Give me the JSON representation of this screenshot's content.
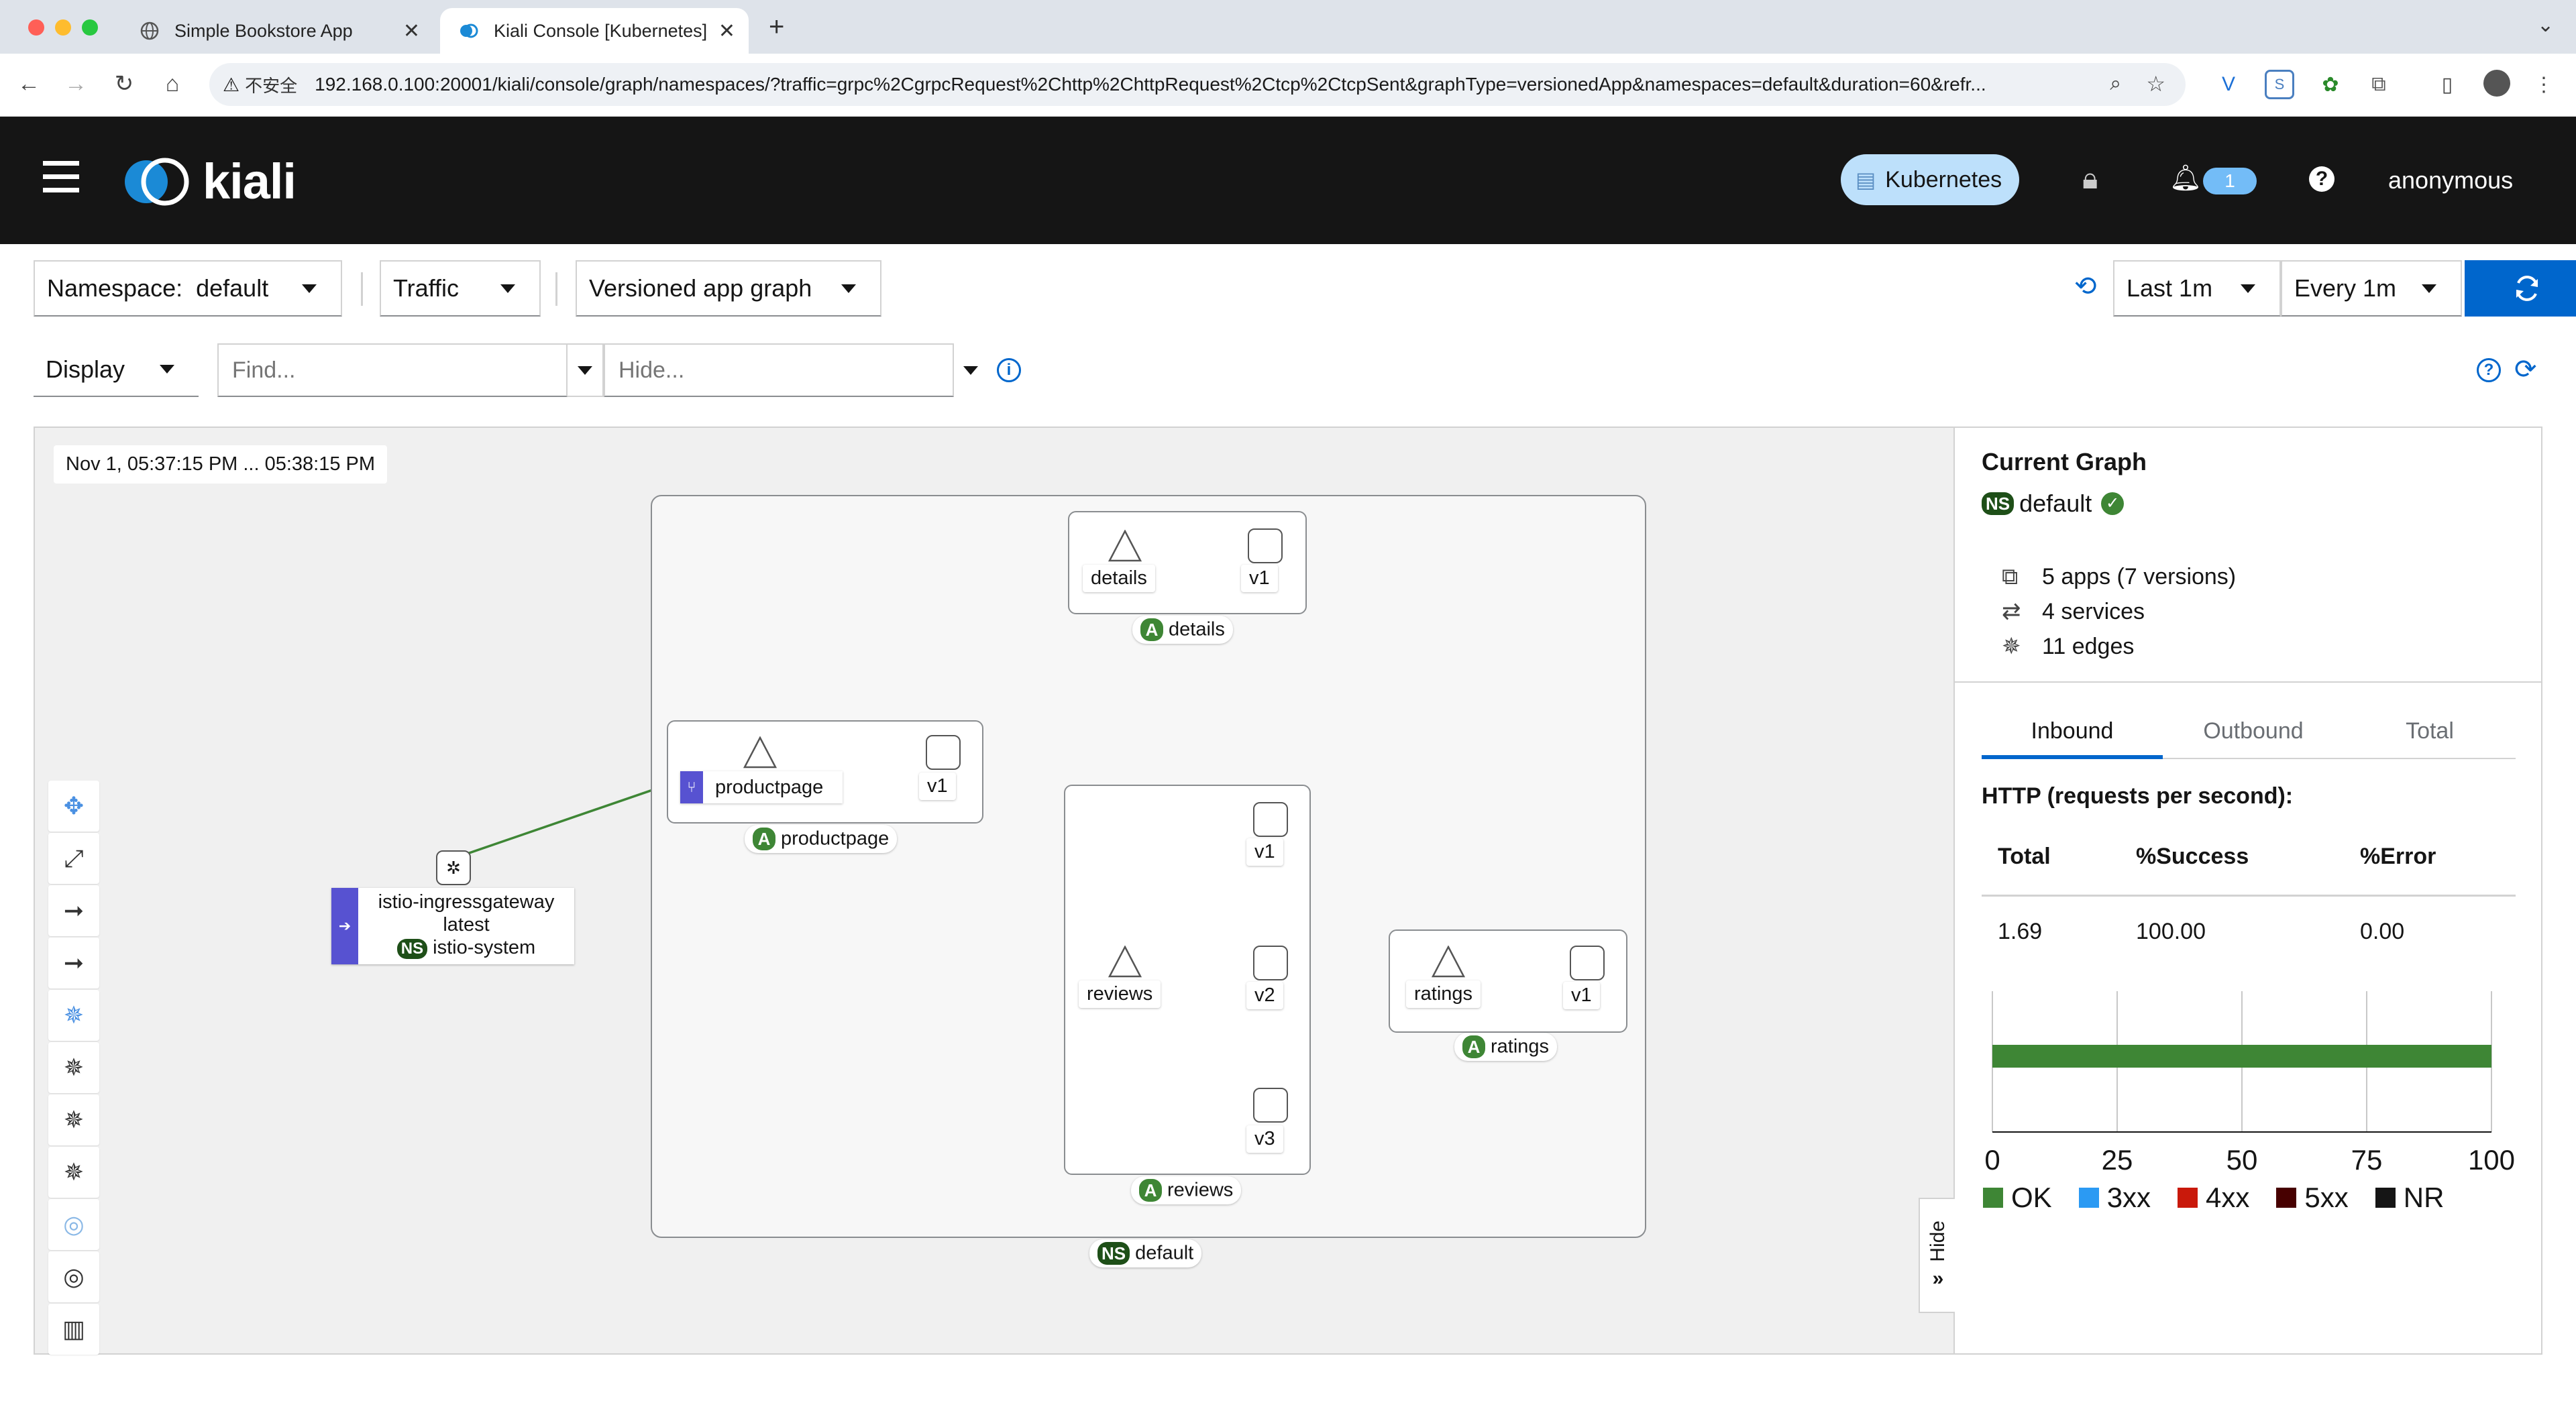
{
  "browser": {
    "tabs": [
      {
        "title": "Simple Bookstore App",
        "active": false
      },
      {
        "title": "Kiali Console [Kubernetes]",
        "active": true
      }
    ],
    "url": "192.168.0.100:20001/kiali/console/graph/namespaces/?traffic=grpc%2CgrpcRequest%2Chttp%2ChttpRequest%2Ctcp%2CtcpSent&graphType=versionedApp&namespaces=default&duration=60&refr...",
    "security_label": "不安全"
  },
  "header": {
    "logo_text": "kiali",
    "cluster": "Kubernetes",
    "notification_count": "1",
    "user": "anonymous"
  },
  "toolbar": {
    "namespace_label": "Namespace:",
    "namespace_value": "default",
    "traffic": "Traffic",
    "graph_type": "Versioned app graph",
    "duration": "Last 1m",
    "refresh": "Every 1m",
    "display": "Display",
    "find_placeholder": "Find...",
    "hide_placeholder": "Hide..."
  },
  "graph": {
    "timestamp": "Nov 1, 05:37:15 PM ... 05:38:15 PM",
    "nodes": {
      "gateway_name": "istio-ingressgateway",
      "gateway_version": "latest",
      "gateway_ns": "istio-system",
      "productpage": "productpage",
      "productpage_v1": "v1",
      "productpage_app": "productpage",
      "details": "details",
      "details_v1": "v1",
      "details_app": "details",
      "reviews": "reviews",
      "reviews_v1": "v1",
      "reviews_v2": "v2",
      "reviews_v3": "v3",
      "reviews_app": "reviews",
      "ratings": "ratings",
      "ratings_v1": "v1",
      "ratings_app": "ratings",
      "namespace": "default"
    },
    "badge_app": "A",
    "badge_ns": "NS",
    "hide_label": "Hide"
  },
  "side_panel": {
    "title": "Current Graph",
    "namespace": "default",
    "apps": "5 apps (7 versions)",
    "services": "4 services",
    "edges": "11 edges",
    "tabs": [
      "Inbound",
      "Outbound",
      "Total"
    ],
    "section_title": "HTTP (requests per second):",
    "table_headers": [
      "Total",
      "%Success",
      "%Error"
    ],
    "table_values": [
      "1.69",
      "100.00",
      "0.00"
    ]
  },
  "chart_data": {
    "type": "bar",
    "orientation": "horizontal",
    "series": [
      {
        "name": "OK",
        "values": [
          100
        ]
      },
      {
        "name": "3xx",
        "values": [
          0
        ]
      },
      {
        "name": "4xx",
        "values": [
          0
        ]
      },
      {
        "name": "5xx",
        "values": [
          0
        ]
      },
      {
        "name": "NR",
        "values": [
          0
        ]
      }
    ],
    "xlim": [
      0,
      100
    ],
    "x_ticks": [
      "0",
      "25",
      "50",
      "75",
      "100"
    ],
    "legend_placement": "bottom",
    "colors": {
      "OK": "#3e8635",
      "3xx": "#2b9af3",
      "4xx": "#c9190b",
      "5xx": "#470000",
      "NR": "#151515"
    }
  },
  "colors": {
    "accent": "#0066cc",
    "success": "#3e8635",
    "header_bg": "#151515",
    "edge": "#3e8635"
  }
}
